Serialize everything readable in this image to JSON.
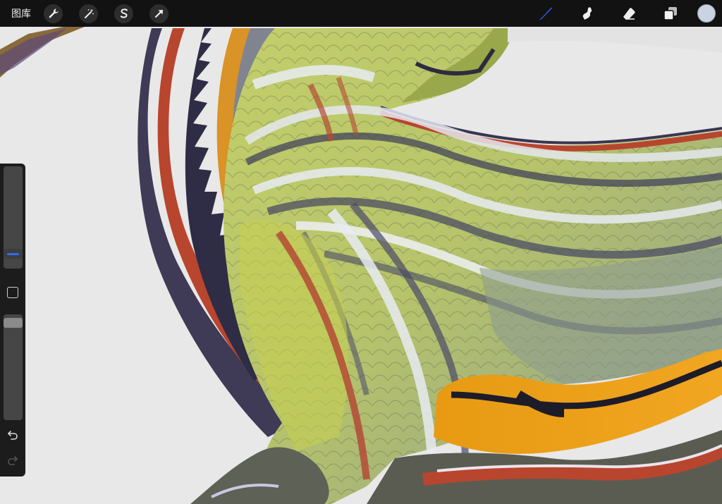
{
  "toolbar": {
    "gallery_label": "图库",
    "left_tools": [
      {
        "name": "actions",
        "icon": "wrench-icon"
      },
      {
        "name": "adjustments",
        "icon": "magic-wand-icon"
      },
      {
        "name": "selection",
        "icon": "selection-s-icon"
      },
      {
        "name": "transform",
        "icon": "arrow-cursor-icon"
      }
    ],
    "right_tools": [
      {
        "name": "brush",
        "icon": "brush-icon",
        "active": true
      },
      {
        "name": "smudge",
        "icon": "smudge-icon",
        "active": false
      },
      {
        "name": "eraser",
        "icon": "eraser-icon",
        "active": false
      },
      {
        "name": "layers",
        "icon": "layers-icon",
        "active": false
      }
    ],
    "current_color": "#c9d3e1",
    "active_tool_color": "#2f6bff"
  },
  "sidebar": {
    "brush_size_slider": {
      "icon": "size-slider-icon"
    },
    "modifier_button": {
      "icon": "square-icon"
    },
    "opacity_slider": {
      "icon": "opacity-slider-icon"
    },
    "undo": {
      "icon": "undo-icon",
      "enabled": true
    },
    "redo": {
      "icon": "redo-icon",
      "enabled": false
    }
  },
  "canvas": {
    "subject": "dinosaur-artwork",
    "background_color": "#e8e8e8"
  }
}
